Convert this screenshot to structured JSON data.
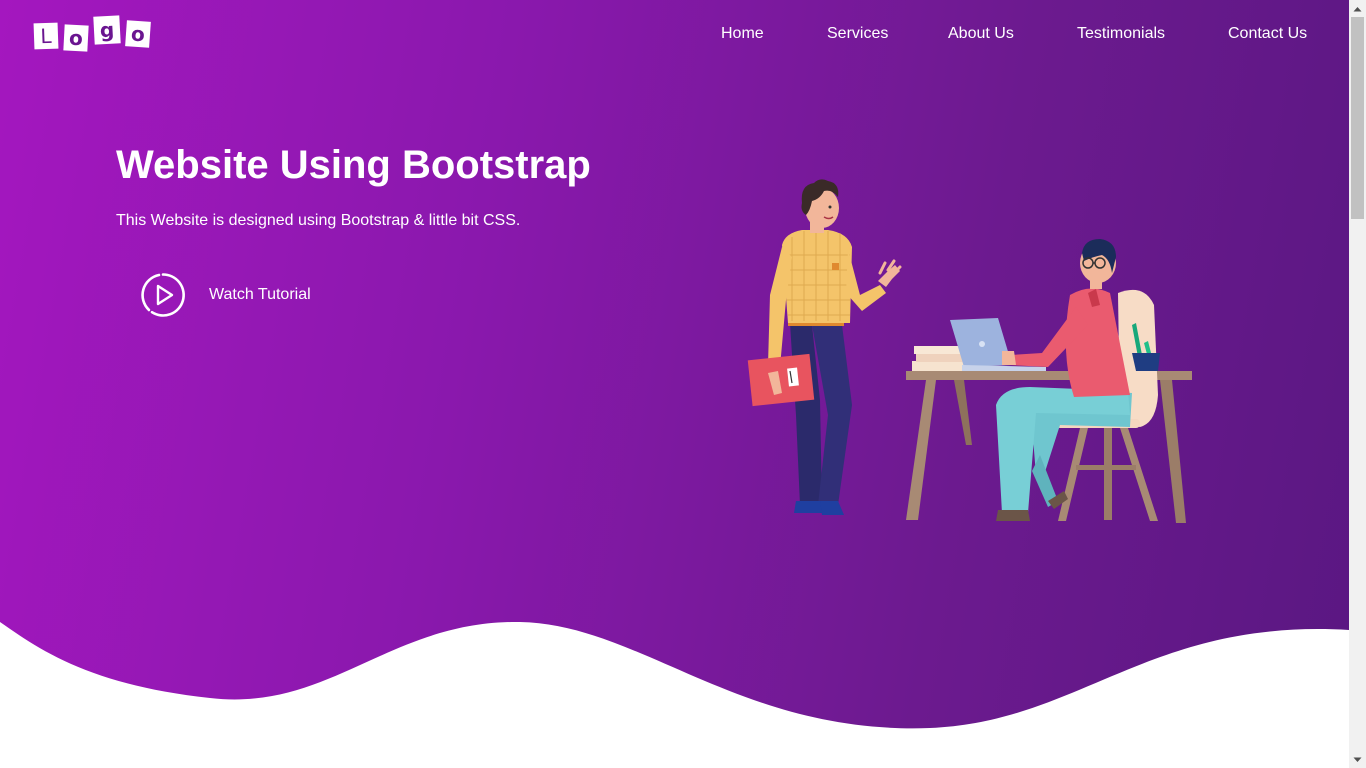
{
  "logo": {
    "letters": [
      "L",
      "o",
      "g",
      "o"
    ]
  },
  "nav": {
    "items": [
      {
        "label": "Home"
      },
      {
        "label": "Services"
      },
      {
        "label": "About Us"
      },
      {
        "label": "Testimonials"
      },
      {
        "label": "Contact Us"
      }
    ]
  },
  "hero": {
    "title": "Website Using Bootstrap",
    "subtitle": "This Website is designed using Bootstrap & little bit CSS.",
    "cta_label": "Watch Tutorial"
  },
  "colors": {
    "gradient_start": "#a417bf",
    "gradient_end": "#5a1782",
    "text": "#ffffff"
  },
  "icons": [
    "play-circle-icon",
    "scroll-up-arrow-icon",
    "scroll-down-arrow-icon"
  ]
}
